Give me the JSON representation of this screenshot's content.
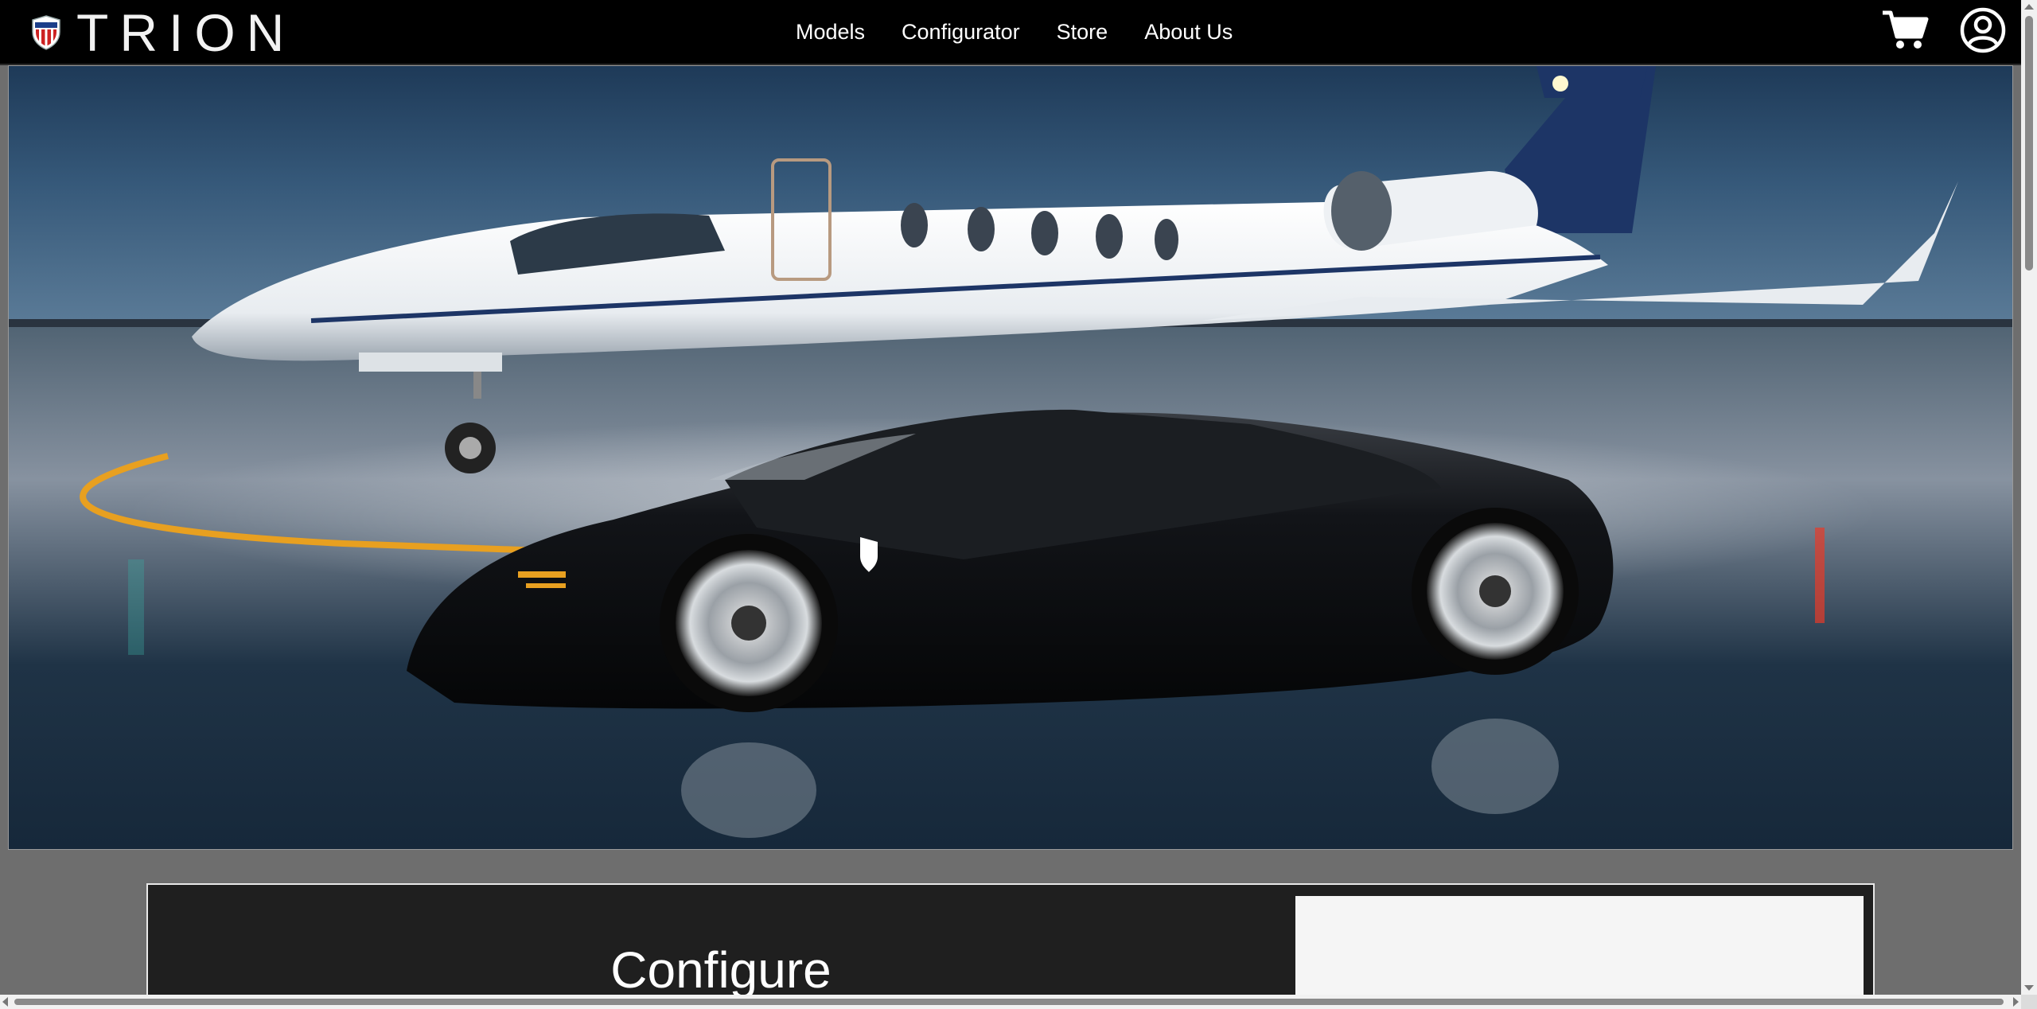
{
  "brand": {
    "name": "TRION"
  },
  "nav": {
    "items": [
      {
        "label": "Models"
      },
      {
        "label": "Configurator"
      },
      {
        "label": "Store"
      },
      {
        "label": "About Us"
      }
    ]
  },
  "header_icons": {
    "cart": "shopping-cart-icon",
    "account": "account-circle-icon"
  },
  "configure": {
    "title": "Configure"
  },
  "colors": {
    "header_bg": "#000000",
    "page_bg": "#6e6e6e",
    "panel_bg": "#1f1f1f",
    "preview_bg": "#f5f5f5",
    "accent": "#ffffff"
  }
}
